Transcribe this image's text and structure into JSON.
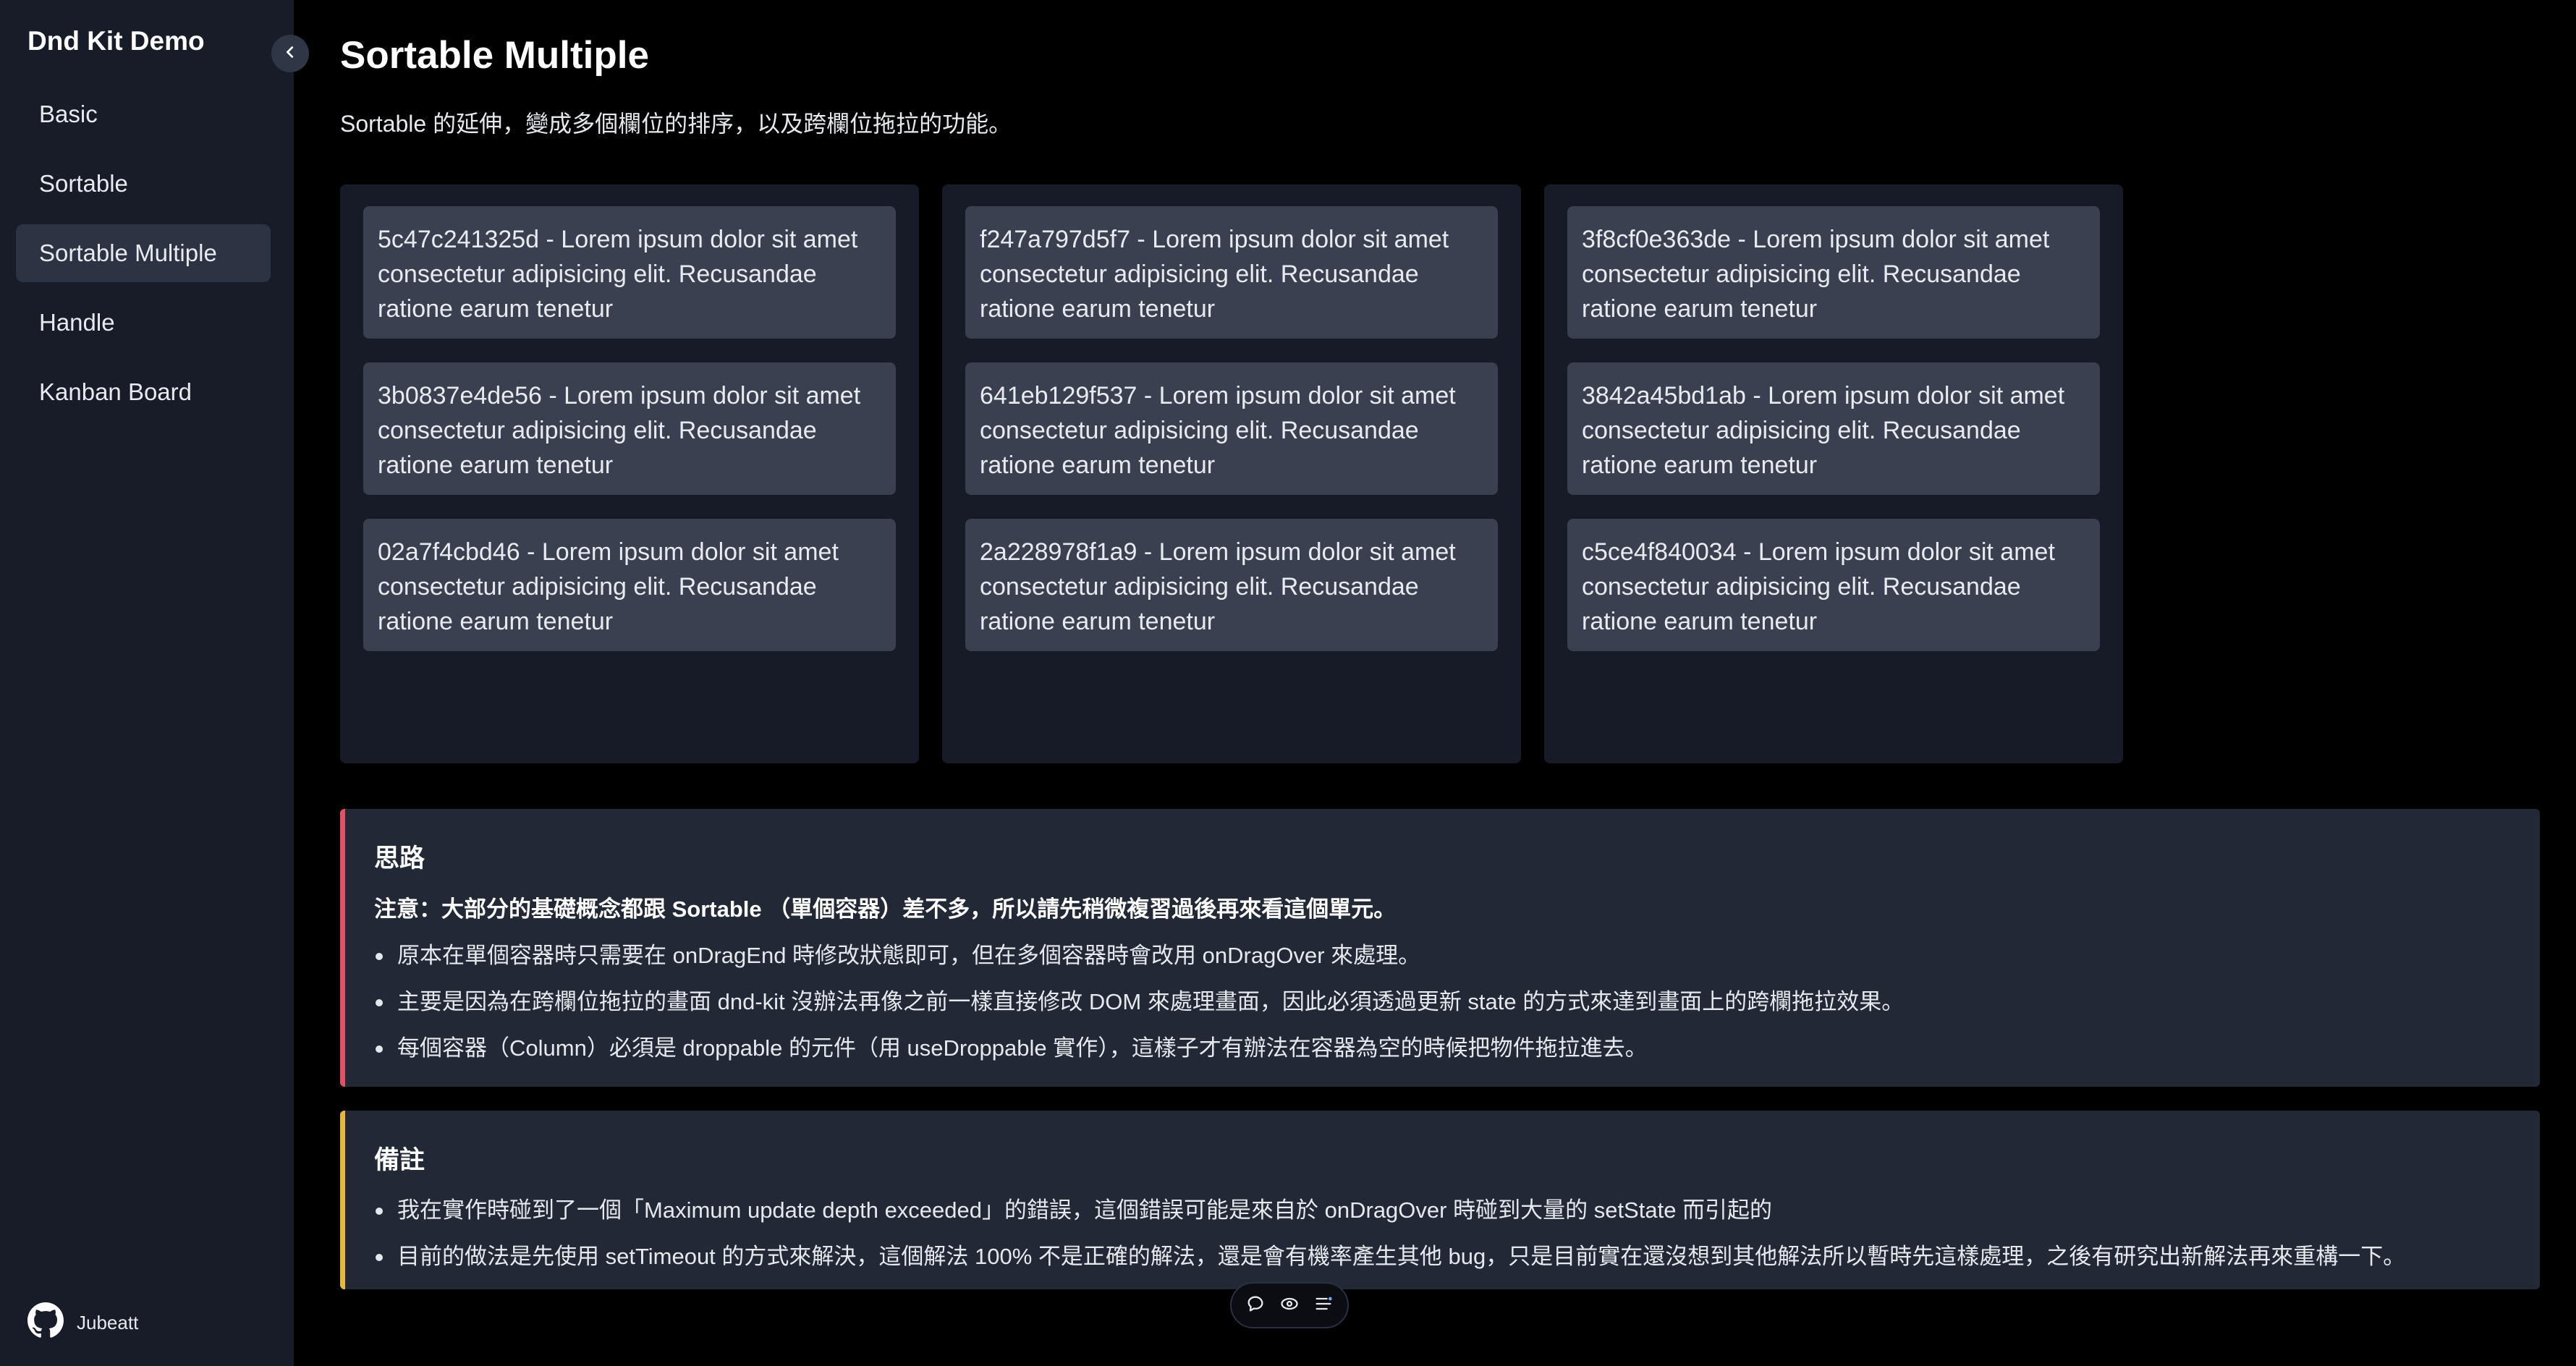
{
  "sidebar": {
    "app_title": "Dnd Kit Demo",
    "items": [
      {
        "label": "Basic"
      },
      {
        "label": "Sortable"
      },
      {
        "label": "Sortable Multiple",
        "active": true
      },
      {
        "label": "Handle"
      },
      {
        "label": "Kanban Board"
      }
    ],
    "footer": {
      "github_user": "Jubeatt",
      "icon": "github-icon"
    },
    "collapse_icon": "chevron-left-icon"
  },
  "main": {
    "title": "Sortable Multiple",
    "description": "Sortable 的延伸，變成多個欄位的排序，以及跨欄位拖拉的功能。",
    "columns": [
      {
        "cards": [
          {
            "text": "5c47c241325d - Lorem ipsum dolor sit amet consectetur adipisicing elit. Recusandae ratione earum tenetur"
          },
          {
            "text": "3b0837e4de56 - Lorem ipsum dolor sit amet consectetur adipisicing elit. Recusandae ratione earum tenetur"
          },
          {
            "text": "02a7f4cbd46 - Lorem ipsum dolor sit amet consectetur adipisicing elit. Recusandae ratione earum tenetur"
          }
        ]
      },
      {
        "cards": [
          {
            "text": "f247a797d5f7 - Lorem ipsum dolor sit amet consectetur adipisicing elit. Recusandae ratione earum tenetur"
          },
          {
            "text": "641eb129f537 - Lorem ipsum dolor sit amet consectetur adipisicing elit. Recusandae ratione earum tenetur"
          },
          {
            "text": "2a228978f1a9 - Lorem ipsum dolor sit amet consectetur adipisicing elit. Recusandae ratione earum tenetur"
          }
        ]
      },
      {
        "cards": [
          {
            "text": "3f8cf0e363de - Lorem ipsum dolor sit amet consectetur adipisicing elit. Recusandae ratione earum tenetur"
          },
          {
            "text": "3842a45bd1ab - Lorem ipsum dolor sit amet consectetur adipisicing elit. Recusandae ratione earum tenetur"
          },
          {
            "text": "c5ce4f840034 - Lorem ipsum dolor sit amet consectetur adipisicing elit. Recusandae ratione earum tenetur"
          }
        ]
      }
    ],
    "thoughts": {
      "title": "思路",
      "note": "注意：大部分的基礎概念都跟 Sortable （單個容器）差不多，所以請先稍微複習過後再來看這個單元。",
      "items": [
        "原本在單個容器時只需要在 onDragEnd 時修改狀態即可，但在多個容器時會改用 onDragOver 來處理。",
        "主要是因為在跨欄位拖拉的畫面 dnd-kit 沒辦法再像之前一樣直接修改 DOM 來處理畫面，因此必須透過更新 state 的方式來達到畫面上的跨欄拖拉效果。",
        "每個容器（Column）必須是 droppable 的元件（用 useDroppable 實作），這樣子才有辦法在容器為空的時候把物件拖拉進去。"
      ],
      "accent": "#e05263"
    },
    "remarks": {
      "title": "備註",
      "items": [
        "我在實作時碰到了一個「Maximum update depth exceeded」的錯誤，這個錯誤可能是來自於 onDragOver 時碰到大量的 setState 而引起的",
        "目前的做法是先使用 setTimeout 的方式來解決，這個解法 100% 不是正確的解法，還是會有機率產生其他 bug，只是目前實在還沒想到其他解法所以暫時先這樣處理，之後有研究出新解法再來重構一下。"
      ],
      "accent": "#e6b93c"
    }
  },
  "toolbar": {
    "icons": [
      "comment-icon",
      "eye-icon",
      "menu-icon"
    ]
  }
}
